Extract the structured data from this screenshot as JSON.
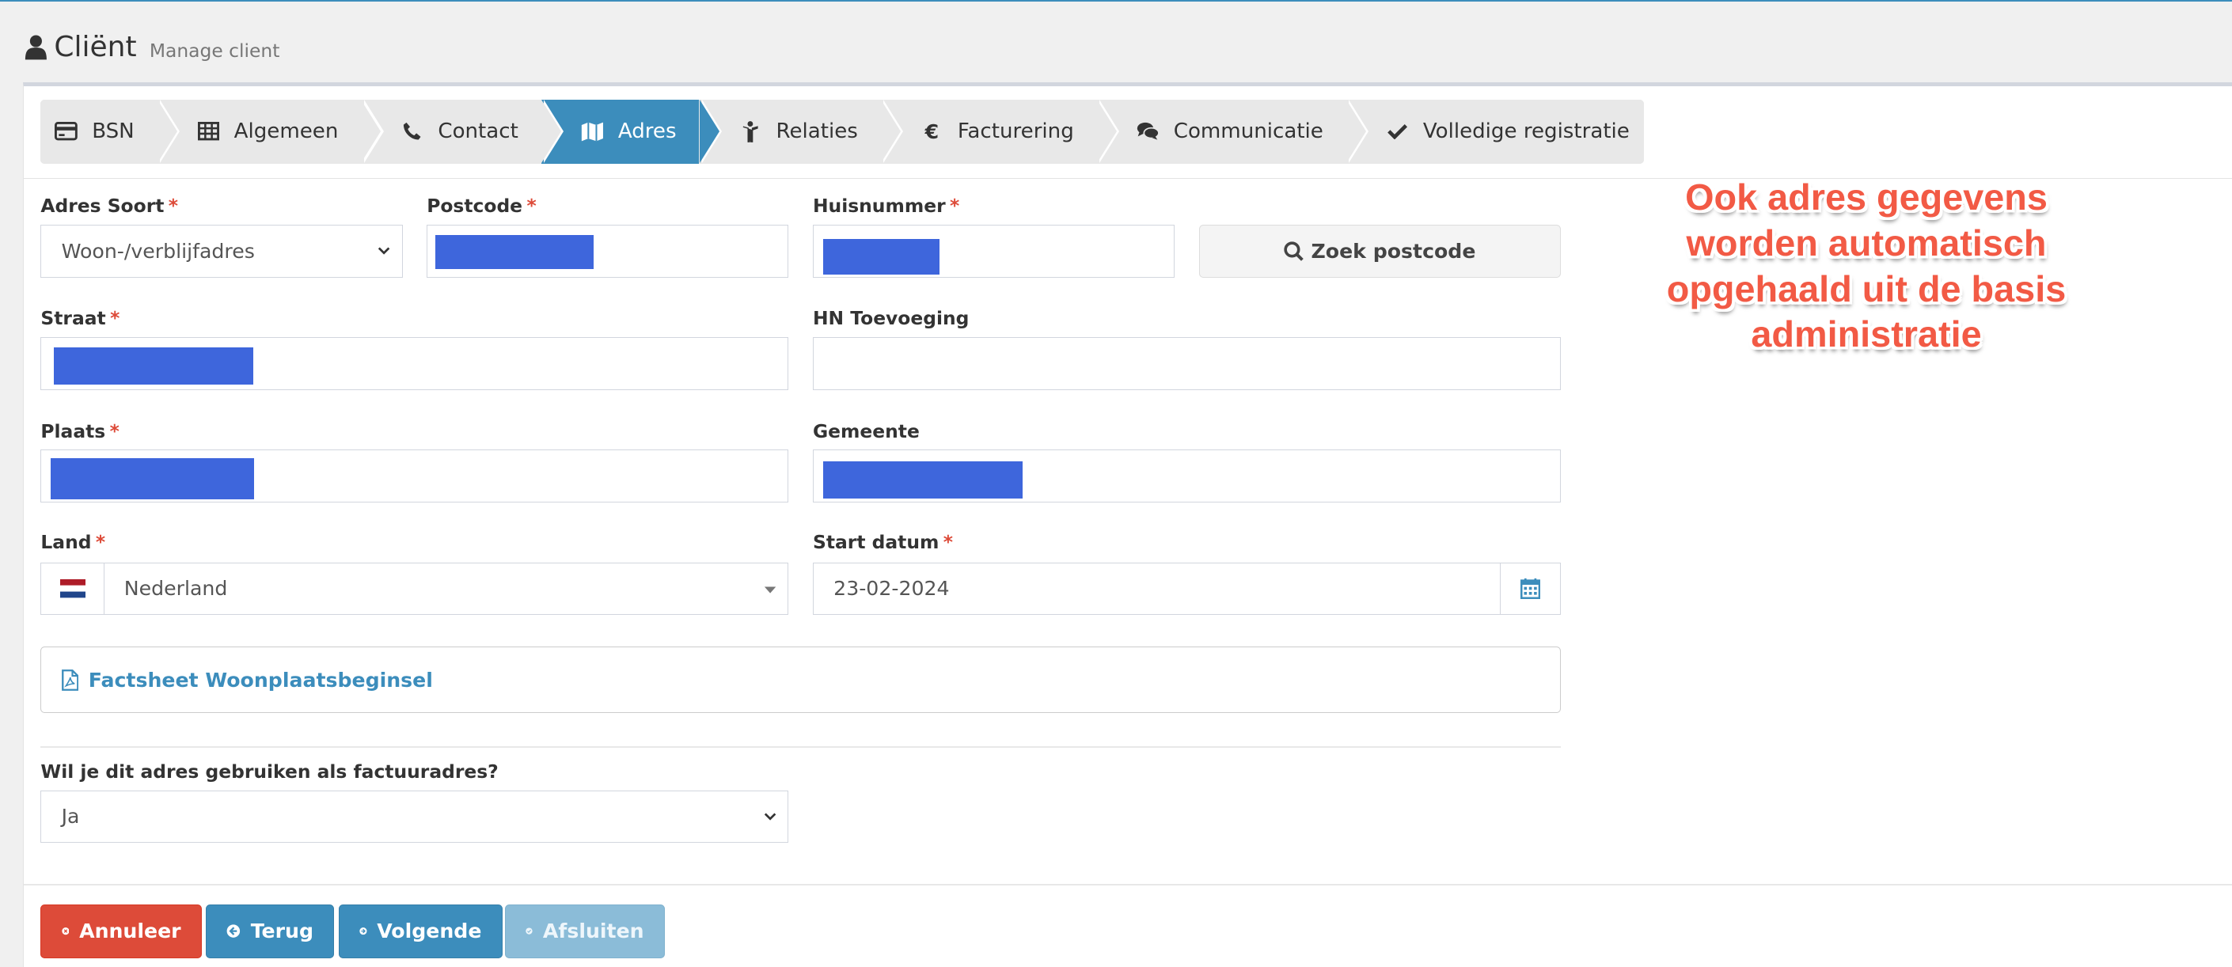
{
  "header": {
    "title": "Cliënt",
    "subtitle": "Manage client"
  },
  "wizard": {
    "steps": [
      {
        "label": "BSN",
        "icon": "credit-card-icon"
      },
      {
        "label": "Algemeen",
        "icon": "table-icon"
      },
      {
        "label": "Contact",
        "icon": "phone-icon"
      },
      {
        "label": "Adres",
        "icon": "map-icon",
        "active": true
      },
      {
        "label": "Relaties",
        "icon": "person-icon"
      },
      {
        "label": "Facturering",
        "icon": "euro-icon"
      },
      {
        "label": "Communicatie",
        "icon": "comments-icon"
      },
      {
        "label": "Volledige registratie",
        "icon": "check-icon"
      }
    ]
  },
  "form": {
    "adres_soort": {
      "label": "Adres Soort",
      "required": "*",
      "value": "Woon-/verblijfadres"
    },
    "postcode": {
      "label": "Postcode",
      "required": "*",
      "value": ""
    },
    "huisnummer": {
      "label": "Huisnummer",
      "required": "*",
      "value": ""
    },
    "zoek_postcode": {
      "label": "Zoek postcode"
    },
    "straat": {
      "label": "Straat",
      "required": "*",
      "value": ""
    },
    "hn_toevoeging": {
      "label": "HN Toevoeging",
      "value": ""
    },
    "plaats": {
      "label": "Plaats",
      "required": "*",
      "value": ""
    },
    "gemeente": {
      "label": "Gemeente",
      "value": ""
    },
    "land": {
      "label": "Land",
      "required": "*",
      "value": "Nederland"
    },
    "start_datum": {
      "label": "Start datum",
      "required": "*",
      "value": "23-02-2024"
    },
    "factsheet": {
      "label": "Factsheet Woonplaatsbeginsel"
    },
    "factuuradres": {
      "label": "Wil je dit adres gebruiken als factuuradres?",
      "value": "Ja"
    }
  },
  "buttons": {
    "annuleer": "Annuleer",
    "terug": "Terug",
    "volgende": "Volgende",
    "afsluiten": "Afsluiten"
  },
  "annotation": {
    "text": "Ook adres gegevens worden automatisch opgehaald uit de basis administratie"
  },
  "colors": {
    "primary": "#3c8dbc",
    "danger": "#dd4b39",
    "redaction": "#3e66dc",
    "annotation": "#f25a45"
  }
}
